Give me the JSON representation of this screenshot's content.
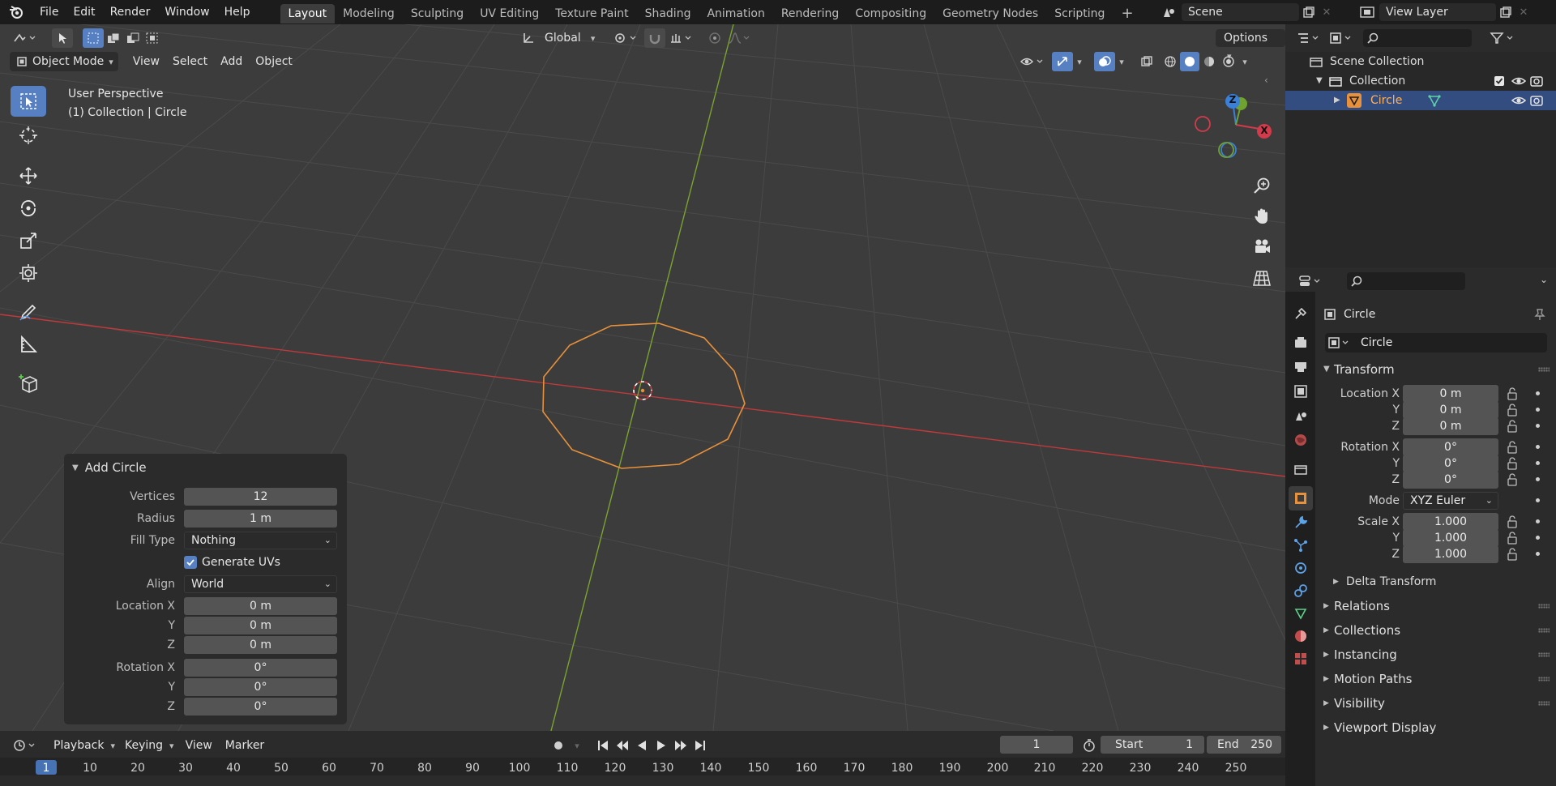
{
  "menu": {
    "items": [
      "File",
      "Edit",
      "Render",
      "Window",
      "Help"
    ],
    "workspaces": [
      "Layout",
      "Modeling",
      "Sculpting",
      "UV Editing",
      "Texture Paint",
      "Shading",
      "Animation",
      "Rendering",
      "Compositing",
      "Geometry Nodes",
      "Scripting"
    ],
    "active_workspace": "Layout",
    "add_workspace": "+",
    "scene": "Scene",
    "view_layer": "View Layer"
  },
  "viewport": {
    "header": {
      "transform_orientation": "Global",
      "options": "Options",
      "mode": "Object Mode",
      "menus": [
        "View",
        "Select",
        "Add",
        "Object"
      ]
    },
    "overlay_text": {
      "perspective": "User Perspective",
      "collection_info": "(1) Collection | Circle"
    },
    "gizmo": {
      "z": "Z",
      "x": "X"
    },
    "colors": {
      "x_axis": "#c0393b",
      "y_axis": "#7aa32f",
      "selection": "#e8913a",
      "active_tool": "#5680c2"
    }
  },
  "redo_panel": {
    "title": "Add Circle",
    "vertices_label": "Vertices",
    "vertices": "12",
    "radius_label": "Radius",
    "radius": "1 m",
    "fill_type_label": "Fill Type",
    "fill_type": "Nothing",
    "generate_uvs": "Generate UVs",
    "generate_uvs_checked": true,
    "align_label": "Align",
    "align": "World",
    "location_x_label": "Location X",
    "location_x": "0 m",
    "location_y_label": "Y",
    "location_y": "0 m",
    "location_z_label": "Z",
    "location_z": "0 m",
    "rotation_x_label": "Rotation X",
    "rotation_x": "0°",
    "rotation_y_label": "Y",
    "rotation_y": "0°",
    "rotation_z_label": "Z",
    "rotation_z": "0°"
  },
  "timeline": {
    "menus": [
      "Playback",
      "Keying",
      "View",
      "Marker"
    ],
    "current_frame": "1",
    "start_label": "Start",
    "start": "1",
    "end_label": "End",
    "end": "250",
    "ruler": [
      "1",
      "10",
      "20",
      "30",
      "40",
      "50",
      "60",
      "70",
      "80",
      "90",
      "100",
      "110",
      "120",
      "130",
      "140",
      "150",
      "160",
      "170",
      "180",
      "190",
      "200",
      "210",
      "220",
      "230",
      "240",
      "250"
    ]
  },
  "outliner": {
    "scene_collection": "Scene Collection",
    "collection": "Collection",
    "object": "Circle"
  },
  "properties": {
    "object_name": "Circle",
    "datablock_name": "Circle",
    "transform": "Transform",
    "location_x_label": "Location X",
    "location_x": "0 m",
    "location_y_label": "Y",
    "location_y": "0 m",
    "location_z_label": "Z",
    "location_z": "0 m",
    "rotation_x_label": "Rotation X",
    "rotation_x": "0°",
    "rotation_y_label": "Y",
    "rotation_y": "0°",
    "rotation_z_label": "Z",
    "rotation_z": "0°",
    "mode_label": "Mode",
    "mode": "XYZ Euler",
    "scale_x_label": "Scale X",
    "scale_x": "1.000",
    "scale_y_label": "Y",
    "scale_y": "1.000",
    "scale_z_label": "Z",
    "scale_z": "1.000",
    "delta_transform": "Delta Transform",
    "sections": [
      "Relations",
      "Collections",
      "Instancing",
      "Motion Paths",
      "Visibility",
      "Viewport Display"
    ]
  }
}
